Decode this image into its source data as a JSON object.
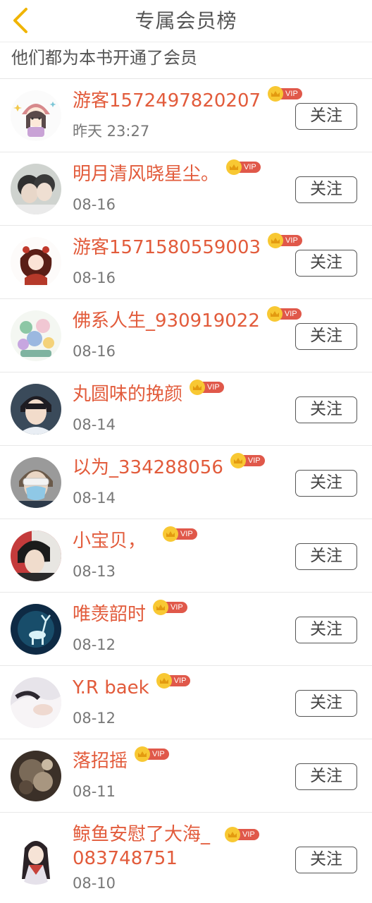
{
  "header": {
    "title": "专属会员榜",
    "back_icon": "chevron-left-icon",
    "accent": "#f0b400"
  },
  "subtitle": "他们都为本书开通了会员",
  "vip_label": "VIP",
  "follow_label": "关注",
  "colors": {
    "name": "#e25b3b",
    "vip_badge": "#e0584a",
    "crown": "#f8c833"
  },
  "members": [
    {
      "name": "游客1572497820207",
      "date": "昨天 23:27",
      "avatar": "cartoon-girl"
    },
    {
      "name": "明月清风晓星尘。",
      "date": "08-16",
      "avatar": "couple-photo"
    },
    {
      "name": "游客1571580559003",
      "date": "08-16",
      "avatar": "anime-girl"
    },
    {
      "name": "佛系人生_930919022",
      "date": "08-16",
      "avatar": "cartoon-group"
    },
    {
      "name": "丸圆味的挽颜",
      "date": "08-14",
      "avatar": "young-man"
    },
    {
      "name": "以为_334288056",
      "date": "08-14",
      "avatar": "masked-person"
    },
    {
      "name": "小宝贝，",
      "date": "08-13",
      "avatar": "dark-hair-person"
    },
    {
      "name": "唯羡韶时",
      "date": "08-12",
      "avatar": "deer-night"
    },
    {
      "name": "Y.R baek",
      "date": "08-12",
      "avatar": "hand-photo"
    },
    {
      "name": "落招摇",
      "date": "08-11",
      "avatar": "dark-scene"
    },
    {
      "name": "鲸鱼安慰了大海_083748751",
      "date": "08-10",
      "avatar": "ancient-woman"
    }
  ]
}
